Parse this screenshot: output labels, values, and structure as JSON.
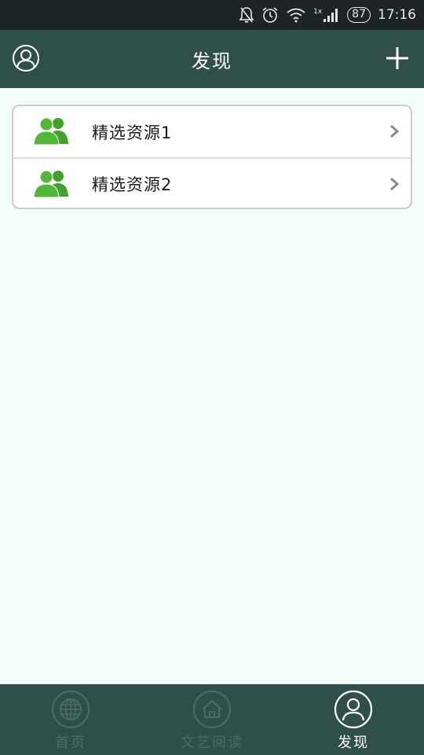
{
  "status_bar": {
    "signal_label": "1x",
    "battery": "87",
    "time": "17:16",
    "icons": [
      "notifications-off-icon",
      "alarm-icon",
      "wifi-icon",
      "signal-icon",
      "battery-icon"
    ]
  },
  "header": {
    "title": "发现",
    "left_icon": "user-profile-icon",
    "right_icon": "add-icon"
  },
  "list": {
    "items": [
      {
        "label": "精选资源1",
        "icon": "users-group-icon"
      },
      {
        "label": "精选资源2",
        "icon": "users-group-icon"
      }
    ]
  },
  "tab_bar": {
    "tabs": [
      {
        "label": "首页",
        "icon": "globe-icon",
        "active": false
      },
      {
        "label": "文艺阅读",
        "icon": "home-icon",
        "active": false
      },
      {
        "label": "发现",
        "icon": "user-profile-icon",
        "active": true
      }
    ]
  },
  "colors": {
    "status_bar_bg": "#1d2428",
    "header_bg": "#2f4f4a",
    "page_bg": "#f3fdf8",
    "icon_green": "#3fa22b",
    "tab_inactive": "#4f6b66",
    "tab_active": "#ffffff"
  }
}
